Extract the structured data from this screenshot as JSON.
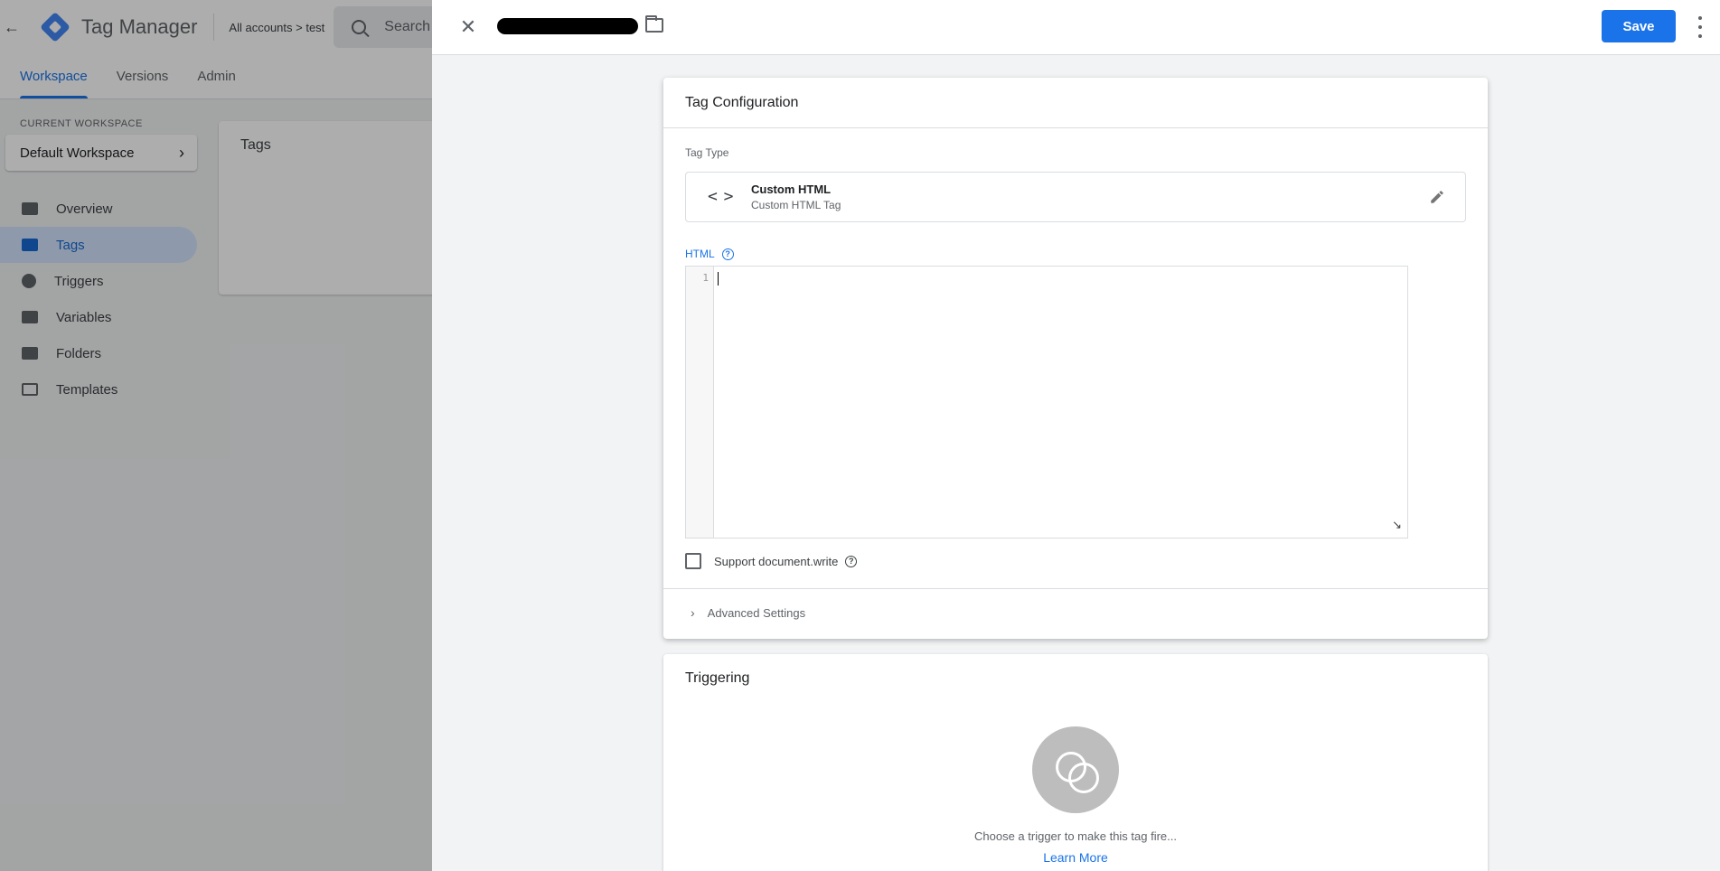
{
  "app": {
    "product_name": "Tag Manager",
    "breadcrumb": "All accounts > test",
    "search_placeholder": "Search",
    "tabs": [
      {
        "label": "Workspace",
        "active": true
      },
      {
        "label": "Versions"
      },
      {
        "label": "Admin"
      }
    ],
    "workspace_caption": "CURRENT WORKSPACE",
    "workspace_name": "Default Workspace",
    "sidebar": [
      {
        "label": "Overview",
        "icon": "briefcase-icon"
      },
      {
        "label": "Tags",
        "icon": "tag-icon",
        "active": true
      },
      {
        "label": "Triggers",
        "icon": "trigger-icon"
      },
      {
        "label": "Variables",
        "icon": "variables-icon"
      },
      {
        "label": "Folders",
        "icon": "folder-icon"
      },
      {
        "label": "Templates",
        "icon": "template-icon"
      }
    ],
    "content_title": "Tags"
  },
  "sheet": {
    "tag_name": "[redacted]",
    "save_label": "Save",
    "config": {
      "title": "Tag Configuration",
      "tag_type_label": "Tag Type",
      "tag_type_name": "Custom HTML",
      "tag_type_sub": "Custom HTML Tag",
      "html_label": "HTML",
      "editor_line": "1",
      "support_docwrite_label": "Support document.write",
      "support_docwrite_checked": false,
      "advanced_label": "Advanced Settings"
    },
    "triggering": {
      "title": "Triggering",
      "hint": "Choose a trigger to make this tag fire...",
      "learn_more": "Learn More"
    }
  },
  "colors": {
    "accent": "#1a73e8",
    "scrim": "rgba(0,0,0,0.32)",
    "active_nav_bg": "#d2e3fc"
  }
}
